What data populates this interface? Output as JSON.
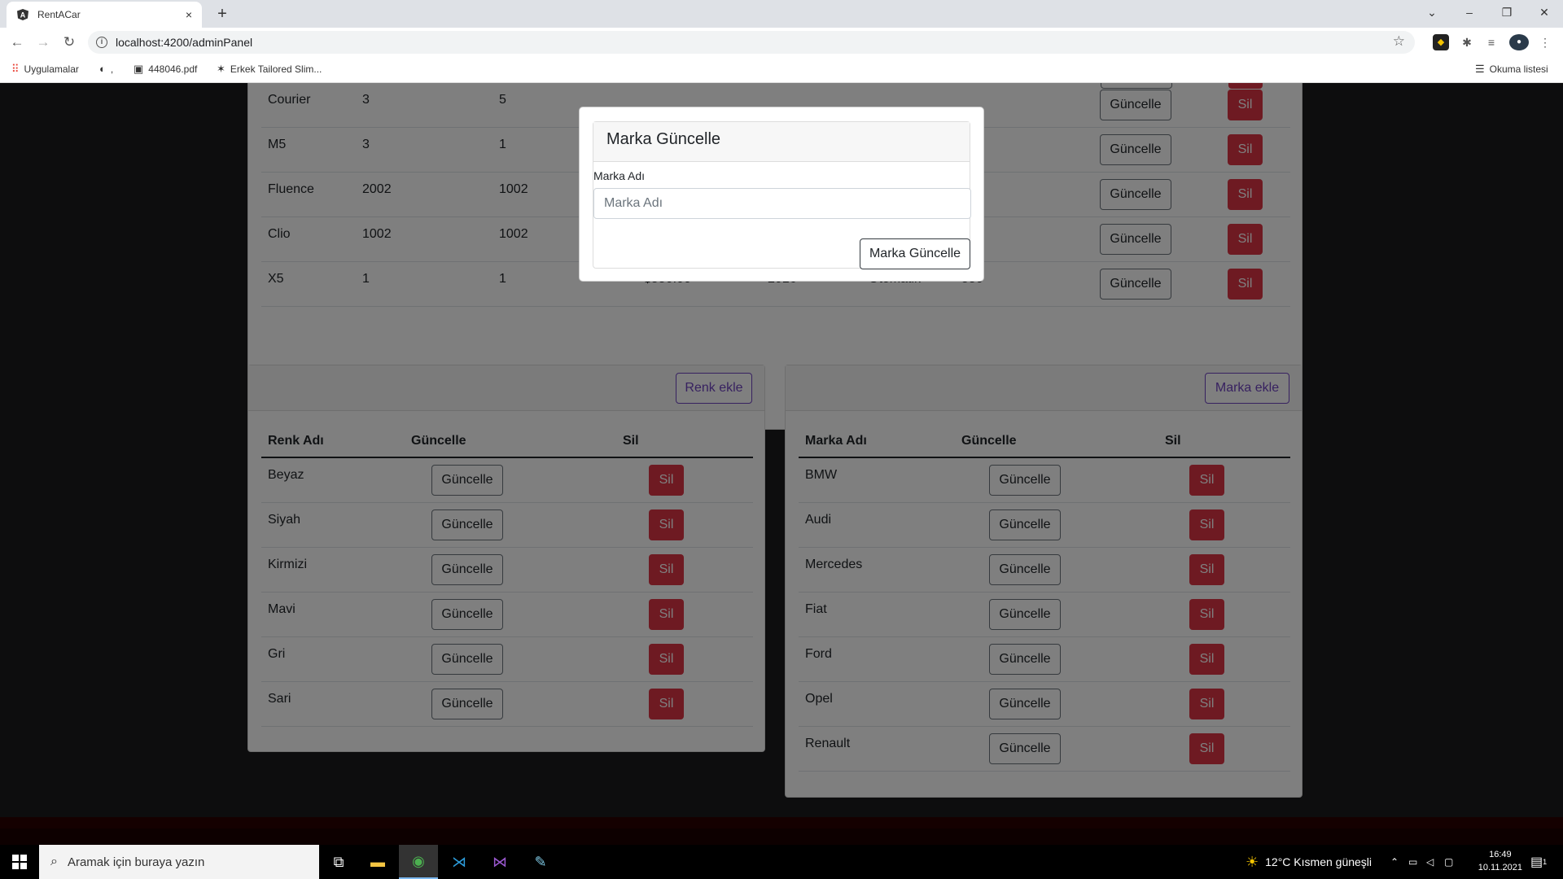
{
  "browser": {
    "tab_title": "RentACar",
    "tab_close": "×",
    "new_tab": "+",
    "url": "localhost:4200/adminPanel",
    "bookmarks": [
      {
        "label": "Uygulamalar"
      },
      {
        "label": ","
      },
      {
        "label": "448046.pdf"
      },
      {
        "label": "Erkek Tailored Slim..."
      }
    ],
    "reading_list": "Okuma listesi"
  },
  "cars": {
    "rows": [
      {
        "name": "Courier",
        "c1": "3",
        "c2": "5",
        "price": "",
        "year": "",
        "gear": "",
        "extra": ""
      },
      {
        "name": "M5",
        "c1": "3",
        "c2": "1",
        "price": "",
        "year": "",
        "gear": "",
        "extra": ""
      },
      {
        "name": "Fluence",
        "c1": "2002",
        "c2": "1002",
        "price": "",
        "year": "",
        "gear": "",
        "extra": ""
      },
      {
        "name": "Clio",
        "c1": "1002",
        "c2": "1002",
        "price": "",
        "year": "",
        "gear": "",
        "extra": ""
      },
      {
        "name": "X5",
        "c1": "1",
        "c2": "1",
        "price": "$550.00",
        "year": "2016",
        "gear": "Otomatik",
        "extra": "550"
      }
    ],
    "update_label": "Güncelle",
    "delete_label": "Sil"
  },
  "colors": {
    "add_button": "Renk ekle",
    "headers": {
      "name": "Renk Adı",
      "update": "Güncelle",
      "delete": "Sil"
    },
    "rows": [
      {
        "name": "Beyaz"
      },
      {
        "name": "Siyah"
      },
      {
        "name": "Kirmizi"
      },
      {
        "name": "Mavi"
      },
      {
        "name": "Gri"
      },
      {
        "name": "Sari"
      }
    ],
    "update_label": "Güncelle",
    "delete_label": "Sil"
  },
  "brands": {
    "add_button": "Marka ekle",
    "headers": {
      "name": "Marka Adı",
      "update": "Güncelle",
      "delete": "Sil"
    },
    "rows": [
      {
        "name": "BMW"
      },
      {
        "name": "Audi"
      },
      {
        "name": "Mercedes"
      },
      {
        "name": "Fiat"
      },
      {
        "name": "Ford"
      },
      {
        "name": "Opel"
      },
      {
        "name": "Renault"
      }
    ],
    "update_label": "Güncelle",
    "delete_label": "Sil"
  },
  "modal": {
    "title": "Marka Güncelle",
    "field_label": "Marka Adı",
    "field_placeholder": "Marka Adı",
    "field_value": "",
    "submit": "Marka Güncelle"
  },
  "taskbar": {
    "search_placeholder": "Aramak için buraya yazın",
    "weather": "12°C  Kısmen güneşli",
    "time": "16:49",
    "date": "10.11.2021",
    "notification_count": "1"
  },
  "theme": {
    "danger": "#dc3545",
    "purple": "#6f42c1",
    "page_bg": "#1b1b1d"
  }
}
